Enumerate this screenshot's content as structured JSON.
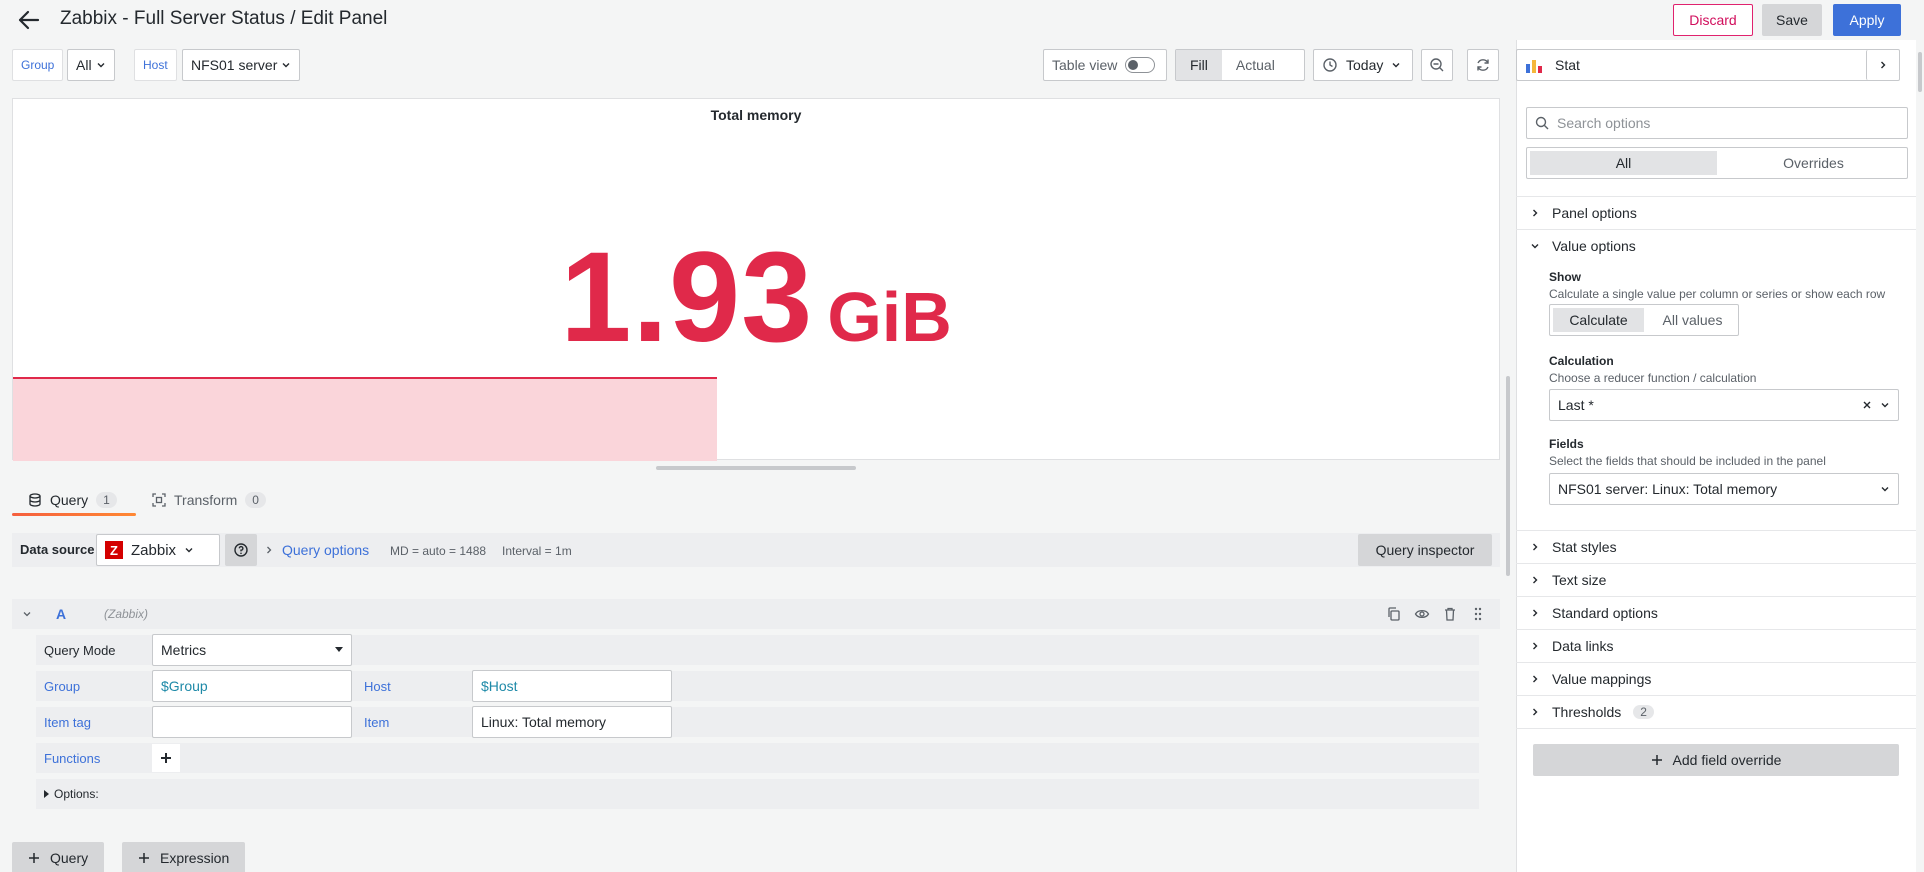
{
  "header": {
    "title": "Zabbix - Full Server Status / Edit Panel",
    "discard_label": "Discard",
    "save_label": "Save",
    "apply_label": "Apply"
  },
  "variables": {
    "group_label": "Group",
    "group_value": "All",
    "host_label": "Host",
    "host_value": "NFS01 server"
  },
  "toolbar": {
    "table_view_label": "Table view",
    "table_view_on": false,
    "fill_label": "Fill",
    "actual_label": "Actual",
    "time_range": "Today"
  },
  "panel": {
    "title": "Total memory",
    "value": "1.93",
    "unit": "GiB",
    "color": "#e0294a"
  },
  "query_tabs": {
    "query_label": "Query",
    "query_count": "1",
    "transform_label": "Transform",
    "transform_count": "0"
  },
  "datasource": {
    "label": "Data source",
    "name": "Zabbix",
    "query_options_label": "Query options",
    "md": "MD = auto = 1488",
    "interval": "Interval = 1m",
    "inspector_label": "Query inspector"
  },
  "query_a": {
    "letter": "A",
    "datasource": "(Zabbix)",
    "query_mode_label": "Query Mode",
    "query_mode_value": "Metrics",
    "group_label": "Group",
    "group_value": "$Group",
    "host_label": "Host",
    "host_value": "$Host",
    "item_tag_label": "Item tag",
    "item_tag_value": "",
    "item_label": "Item",
    "item_value": "Linux: Total memory",
    "functions_label": "Functions",
    "options_label": "Options:"
  },
  "bottom_buttons": {
    "add_query": "Query",
    "add_expression": "Expression"
  },
  "sidepane": {
    "viz_name": "Stat",
    "search_placeholder": "Search options",
    "tab_all": "All",
    "tab_overrides": "Overrides",
    "sections": {
      "panel_options": "Panel options",
      "value_options": "Value options",
      "stat_styles": "Stat styles",
      "text_size": "Text size",
      "standard_options": "Standard options",
      "data_links": "Data links",
      "value_mappings": "Value mappings",
      "thresholds": "Thresholds",
      "thresholds_count": "2"
    },
    "show_title": "Show",
    "show_desc": "Calculate a single value per column or series or show each row",
    "show_calculate": "Calculate",
    "show_all_values": "All values",
    "calc_title": "Calculation",
    "calc_desc": "Choose a reducer function / calculation",
    "calc_value": "Last *",
    "fields_title": "Fields",
    "fields_desc": "Select the fields that should be included in the panel",
    "fields_value": "NFS01 server: Linux: Total memory",
    "add_override": "Add field override"
  }
}
